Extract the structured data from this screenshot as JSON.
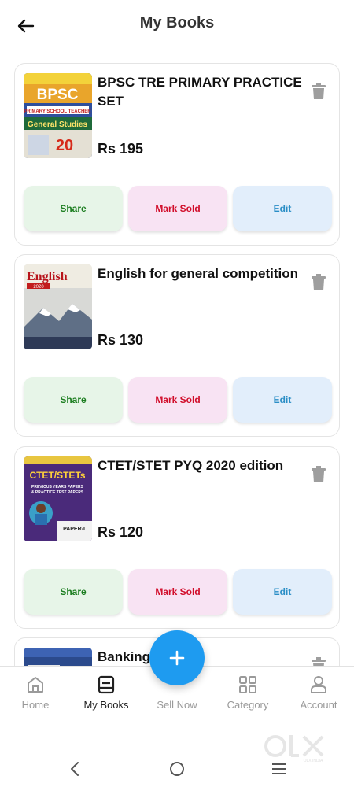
{
  "header": {
    "title": "My Books"
  },
  "books": [
    {
      "title": "BPSC TRE PRIMARY PRACTICE SET",
      "price": "Rs 195",
      "cover_text": [
        "BPSC",
        "PRIMARY SCHOOL TEACHER",
        "General Studies",
        "20"
      ]
    },
    {
      "title": "English for general competition",
      "price": "Rs 130",
      "cover_text": [
        "English",
        "2020"
      ]
    },
    {
      "title": "CTET/STET PYQ 2020 edition",
      "price": "Rs 120",
      "cover_text": [
        "CTET/STETs",
        "PREVIOUS YEARS PAPERS",
        "& PRACTICE TEST PAPERS",
        "PAPER-I"
      ]
    },
    {
      "title": "Banking",
      "price": ""
    }
  ],
  "actions": {
    "share": "Share",
    "mark_sold": "Mark Sold",
    "edit": "Edit"
  },
  "nav": [
    {
      "label": "Home",
      "icon": "home-icon"
    },
    {
      "label": "My Books",
      "icon": "book-icon",
      "active": true
    },
    {
      "label": "Sell Now",
      "icon": "plus-icon"
    },
    {
      "label": "Category",
      "icon": "grid-icon"
    },
    {
      "label": "Account",
      "icon": "user-icon"
    }
  ],
  "watermark": "OLX INDIA",
  "colors": {
    "fab": "#1e9bf0",
    "share_bg": "#e7f5e8",
    "share_text": "#1b7d1f",
    "sold_bg": "#f8e3f3",
    "sold_text": "#d10d2a",
    "edit_bg": "#e2eefb",
    "edit_text": "#2a8ec6"
  }
}
